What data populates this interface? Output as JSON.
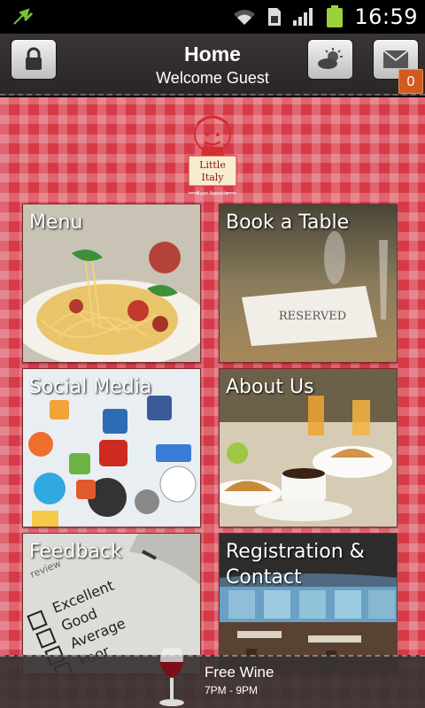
{
  "status_bar": {
    "time": "16:59",
    "icons": [
      "usb-debug-icon",
      "wifi-icon",
      "sim-icon",
      "signal-icon",
      "battery-icon"
    ]
  },
  "header": {
    "title": "Home",
    "subtitle": "Welcome Guest",
    "notification_count": "0",
    "buttons": [
      "lock-icon",
      "weather-icon",
      "mail-icon"
    ]
  },
  "logo": {
    "name_line1": "Little",
    "name_line2": "Italy",
    "tagline": "Buon Appetito"
  },
  "tiles": [
    {
      "label": "Menu"
    },
    {
      "label": "Book a Table",
      "card_text": "RESERVED"
    },
    {
      "label": "Social Media"
    },
    {
      "label": "About Us"
    },
    {
      "label": "Feedback",
      "form_options": [
        "Excellent",
        "Good",
        "Average",
        "Poor"
      ],
      "form_header": "review"
    },
    {
      "label": "Registration & Contact"
    }
  ],
  "promo": {
    "title": "Free Wine",
    "time": "7PM - 9PM"
  },
  "colors": {
    "checker_red": "#d63a48",
    "header_dark": "#2b2626",
    "badge_orange": "#d35a1f"
  }
}
